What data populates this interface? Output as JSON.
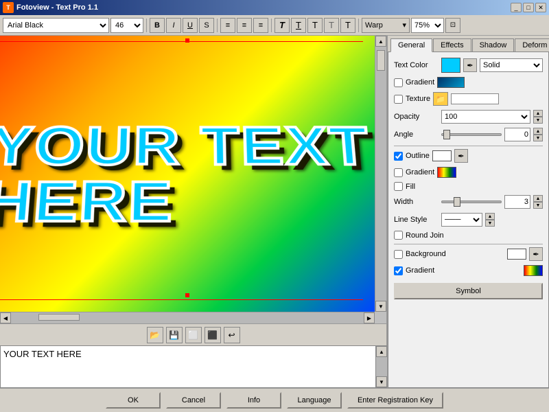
{
  "titleBar": {
    "title": "Fotoview - Text Pro 1.1",
    "icon": "T"
  },
  "toolbar": {
    "fontFamily": "Arial Black",
    "fontSize": "46",
    "boldLabel": "B",
    "italicLabel": "I",
    "underlineLabel": "U",
    "strikeLabel": "S",
    "alignLeft": "≡",
    "alignCenter": "≡",
    "alignRight": "≡",
    "textBtn1": "T",
    "textBtn2": "T",
    "textBtn3": "T",
    "textBtn4": "T",
    "textBtn5": "T",
    "warpLabel": "Warp",
    "zoomValue": "75%"
  },
  "canvasText": "YOUR TEXT HERE",
  "iconToolbar": {
    "btn1": "📂",
    "btn2": "💾",
    "btn3": "⬜",
    "btn4": "⬛",
    "btn5": "↩"
  },
  "textAreaContent": "YOUR TEXT HERE",
  "rightPanel": {
    "tabs": [
      "General",
      "Effects",
      "Shadow",
      "Deform"
    ],
    "activeTab": "General",
    "textColorLabel": "Text Color",
    "solidOption": "Solid",
    "gradientLabel": "Gradient",
    "textureLabel": "Texture",
    "opacityLabel": "Opacity",
    "opacityValue": "100",
    "angleLabel": "Angle",
    "angleValue": "0",
    "outlineLabel": "Outline",
    "outlineChecked": true,
    "gradientLabel2": "Gradient",
    "fillLabel": "Fill",
    "widthLabel": "Width",
    "widthValue": "3",
    "lineStyleLabel": "Line Style",
    "roundJoinLabel": "Round Join",
    "backgroundLabel": "Background",
    "gradientLabel3": "Gradient",
    "gradientChecked": true,
    "symbolLabel": "Symbol"
  },
  "bottomBar": {
    "okLabel": "OK",
    "cancelLabel": "Cancel",
    "infoLabel": "Info",
    "languageLabel": "Language",
    "registrationLabel": "Enter Registration Key"
  }
}
